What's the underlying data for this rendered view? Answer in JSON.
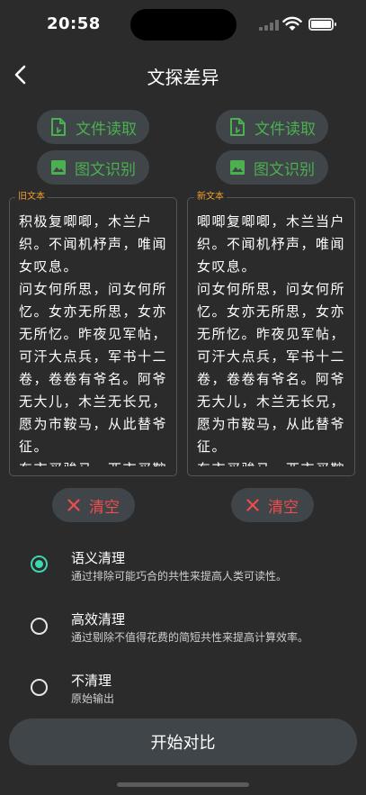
{
  "status": {
    "time": "20:58"
  },
  "nav": {
    "title": "文探差异"
  },
  "left": {
    "file_read": "文件读取",
    "image_ocr": "图文识别",
    "label": "旧文本",
    "text": "积极复唧唧，木兰户织。不闻机杼声，唯闻女叹息。\n问女何所思，问女何所忆。女亦无所思，女亦无所忆。昨夜见军帖，可汗大点兵，军书十二卷，卷卷有爷名。阿爷无大儿，木兰无长兄，愿为市鞍马，从此替爷征。\n东市买骏马，西市买鞍",
    "clear": "清空"
  },
  "right": {
    "file_read": "文件读取",
    "image_ocr": "图文识别",
    "label": "新文本",
    "text": "唧唧复唧唧，木兰当户织。不闻机杼声，唯闻女叹息。\n问女何所思，问女何所忆。女亦无所思，女亦无所忆。昨夜见军帖，可汗大点兵，军书十二卷，卷卷有爷名。阿爷无大儿，木兰无长兄，愿为市鞍马，从此替爷征。\n东市买骏马，西市买鞍",
    "clear": "清空"
  },
  "options": [
    {
      "title": "语义清理",
      "desc": "通过排除可能巧合的共性来提高人类可读性。",
      "checked": true
    },
    {
      "title": "高效清理",
      "desc": "通过剔除不值得花费的简短共性来提高计算效率。",
      "checked": false
    },
    {
      "title": "不清理",
      "desc": "原始输出",
      "checked": false
    }
  ],
  "start_button": "开始对比",
  "colors": {
    "background": "#2b2b2b",
    "button": "#3f4549",
    "accent_green": "#4caf50",
    "accent_red": "#ef4d4d",
    "radio_teal": "#3fd6b0",
    "label_orange": "#f1a02d"
  }
}
